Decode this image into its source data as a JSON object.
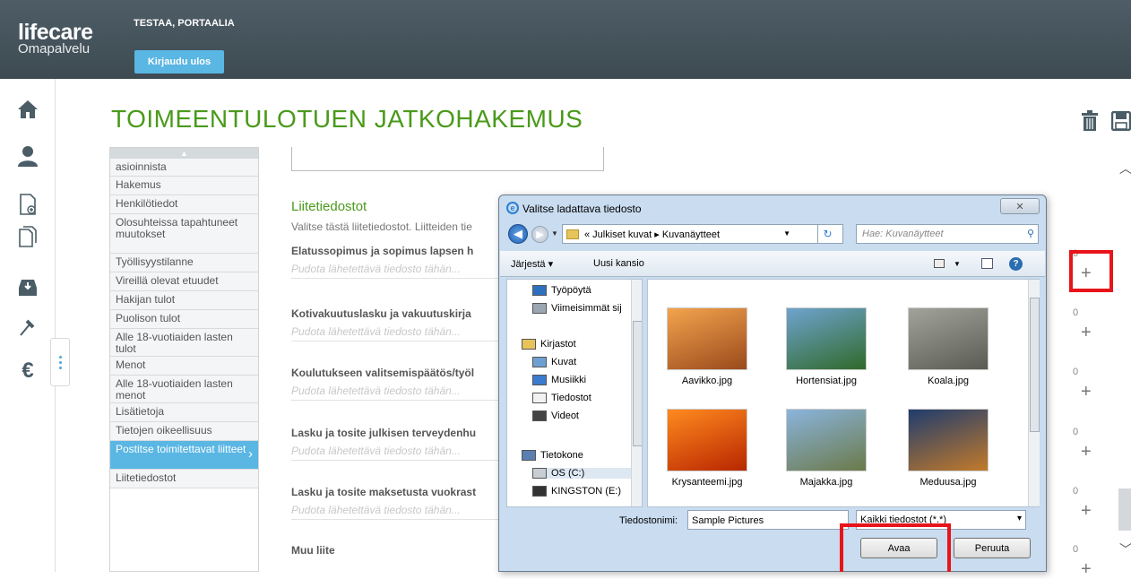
{
  "header": {
    "logo_main": "lifecare",
    "logo_sub": "Omapalvelu",
    "user_name": "TESTAA, PORTAALIA",
    "logout_label": "Kirjaudu ulos"
  },
  "rail_icons": [
    "home-icon",
    "person-icon",
    "new-document-icon",
    "documents-icon",
    "inbox-download-icon",
    "gavel-icon",
    "euro-icon"
  ],
  "page": {
    "title": "TOIMEENTULOTUEN JATKOHAKEMUS",
    "icons": [
      "trash-icon",
      "save-icon"
    ]
  },
  "nav": {
    "items": [
      {
        "label": "asioinnista"
      },
      {
        "label": "Hakemus"
      },
      {
        "label": "Henkilötiedot"
      },
      {
        "label": "Olosuhteissa tapahtuneet muutokset"
      },
      {
        "label": "Työllisyystilanne"
      },
      {
        "label": "Vireillä olevat etuudet"
      },
      {
        "label": "Hakijan tulot"
      },
      {
        "label": "Puolison tulot"
      },
      {
        "label": "Alle 18-vuotiaiden lasten tulot"
      },
      {
        "label": "Menot"
      },
      {
        "label": "Alle 18-vuotiaiden lasten menot"
      },
      {
        "label": "Lisätietoja"
      },
      {
        "label": "Tietojen oikeellisuus"
      },
      {
        "label": "Postitse toimitettavat liitteet"
      },
      {
        "label": "Liitetiedostot"
      }
    ],
    "active_index": 13
  },
  "main": {
    "section_title": "Liitetiedostot",
    "section_desc": "Valitse tästä liitetiedostot. Liitteiden tie",
    "drop_hint": "Pudota lähetettävä tiedosto tähän...",
    "attachments": [
      {
        "title": "Elatussopimus ja sopimus lapsen h",
        "count": "0"
      },
      {
        "title": "Kotivakuutuslasku ja vakuutuskirja",
        "count": "0"
      },
      {
        "title": "Koulutukseen valitsemispäätös/työl",
        "count": "0"
      },
      {
        "title": "Lasku ja tosite julkisen terveydenhu",
        "count": "0"
      },
      {
        "title": "Lasku ja tosite maksetusta vuokrast",
        "count": "0"
      },
      {
        "title": "Muu liite",
        "count": "0"
      }
    ],
    "plus_label": "+"
  },
  "dialog": {
    "title": "Valitse ladattava tiedosto",
    "close_label": "✕",
    "breadcrumb": "« Julkiset kuvat ▸ Kuvanäytteet",
    "search_placeholder": "Hae: Kuvanäytteet",
    "toolbar": {
      "organize": "Järjestä ▾",
      "new_folder": "Uusi kansio"
    },
    "tree": [
      {
        "label": "Työpöytä",
        "icon": "desktop-icon",
        "color": "#2f6fc0"
      },
      {
        "label": "Viimeisimmät sij",
        "icon": "recent-places-icon",
        "color": "#9aa6b2"
      },
      {
        "label": "Kirjastot",
        "icon": "libraries-icon",
        "color": "#e6c45a"
      },
      {
        "label": "Kuvat",
        "icon": "pictures-icon",
        "color": "#6e9fd2"
      },
      {
        "label": "Musiikki",
        "icon": "music-icon",
        "color": "#3b7bd0"
      },
      {
        "label": "Tiedostot",
        "icon": "documents-icon",
        "color": "#f2f2f2"
      },
      {
        "label": "Videot",
        "icon": "videos-icon",
        "color": "#444"
      },
      {
        "label": "Tietokone",
        "icon": "computer-icon",
        "color": "#5a7fb0"
      },
      {
        "label": "OS (C:)",
        "icon": "drive-icon",
        "color": "#c9ced4"
      },
      {
        "label": "KINGSTON (E:)",
        "icon": "usb-drive-icon",
        "color": "#333"
      }
    ],
    "files": [
      {
        "name": "Aavikko.jpg",
        "colors": [
          "#f3a44d",
          "#9a4a1c"
        ]
      },
      {
        "name": "Hortensiat.jpg",
        "colors": [
          "#6fa3cf",
          "#2f6a2a"
        ]
      },
      {
        "name": "Koala.jpg",
        "colors": [
          "#a2a39b",
          "#5a5b52"
        ]
      },
      {
        "name": "Krysanteemi.jpg",
        "colors": [
          "#ff8a1f",
          "#b82600"
        ]
      },
      {
        "name": "Majakka.jpg",
        "colors": [
          "#8ab4dd",
          "#6b7a4a"
        ]
      },
      {
        "name": "Meduusa.jpg",
        "colors": [
          "#1f3c6e",
          "#c27a2a"
        ]
      }
    ],
    "filename_label": "Tiedostonimi:",
    "filename_value": "Sample Pictures",
    "filetype_value": "Kaikki tiedostot (*.*)",
    "open_label": "Avaa",
    "cancel_label": "Peruuta"
  }
}
